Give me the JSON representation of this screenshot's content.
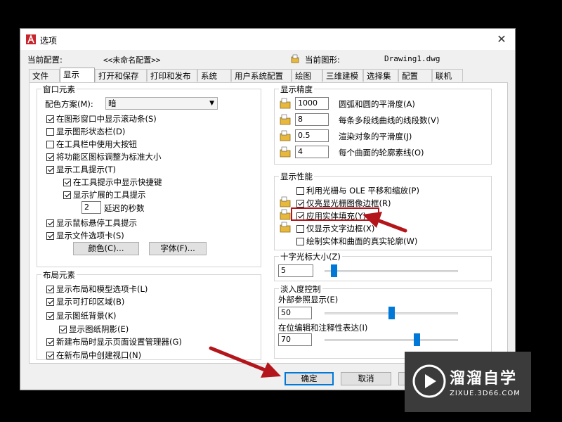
{
  "window": {
    "title": "选项",
    "close_glyph": "✕"
  },
  "profile": {
    "current_config_label": "当前配置:",
    "current_config_value": "<<未命名配置>>",
    "current_drawing_label": "当前图形:",
    "current_drawing_value": "Drawing1.dwg"
  },
  "tabs": [
    {
      "label": "文件"
    },
    {
      "label": "显示",
      "active": true
    },
    {
      "label": "打开和保存"
    },
    {
      "label": "打印和发布"
    },
    {
      "label": "系统"
    },
    {
      "label": "用户系统配置"
    },
    {
      "label": "绘图"
    },
    {
      "label": "三维建模"
    },
    {
      "label": "选择集"
    },
    {
      "label": "配置"
    },
    {
      "label": "联机"
    }
  ],
  "window_elements": {
    "title": "窗口元素",
    "color_scheme_label": "配色方案(M):",
    "color_scheme_value": "暗",
    "checkboxes": [
      {
        "label": "在图形窗口中显示滚动条(S)",
        "checked": true
      },
      {
        "label": "显示图形状态栏(D)",
        "checked": false
      },
      {
        "label": "在工具栏中使用大按钮",
        "checked": false
      },
      {
        "label": "将功能区图标调整为标准大小",
        "checked": true
      },
      {
        "label": "显示工具提示(T)",
        "checked": true
      },
      {
        "label": "在工具提示中显示快捷键",
        "checked": true
      },
      {
        "label": "显示扩展的工具提示",
        "checked": true
      },
      {
        "label": "显示鼠标悬停工具提示",
        "checked": true
      },
      {
        "label": "显示文件选项卡(S)",
        "checked": true
      }
    ],
    "delay_value": "2",
    "delay_label": "延迟的秒数",
    "colors_button": "颜色(C)...",
    "fonts_button": "字体(F)..."
  },
  "layout_elements": {
    "title": "布局元素",
    "checkboxes": [
      {
        "label": "显示布局和模型选项卡(L)",
        "checked": true
      },
      {
        "label": "显示可打印区域(B)",
        "checked": true
      },
      {
        "label": "显示图纸背景(K)",
        "checked": true
      },
      {
        "label": "显示图纸阴影(E)",
        "checked": true
      },
      {
        "label": "新建布局时显示页面设置管理器(G)",
        "checked": true
      },
      {
        "label": "在新布局中创建视口(N)",
        "checked": true
      }
    ]
  },
  "display_resolution": {
    "title": "显示精度",
    "rows": [
      {
        "value": "1000",
        "label": "圆弧和圆的平滑度(A)"
      },
      {
        "value": "8",
        "label": "每条多段线曲线的线段数(V)"
      },
      {
        "value": "0.5",
        "label": "渲染对象的平滑度(J)"
      },
      {
        "value": "4",
        "label": "每个曲面的轮廓素线(O)"
      }
    ]
  },
  "display_performance": {
    "title": "显示性能",
    "checkboxes": [
      {
        "label": "利用光栅与 OLE 平移和缩放(P)",
        "checked": false
      },
      {
        "label": "仅亮显光栅图像边框(R)",
        "checked": true
      },
      {
        "label": "应用实体填充(Y)",
        "checked": true
      },
      {
        "label": "仅显示文字边框(X)",
        "checked": false
      },
      {
        "label": "绘制实体和曲面的真实轮廓(W)",
        "checked": false
      }
    ]
  },
  "crosshair": {
    "title": "十字光标大小(Z)",
    "value": "5",
    "level_percent": 5
  },
  "fade": {
    "title": "淡入度控制",
    "xref_label": "外部参照显示(E)",
    "xref_value": "50",
    "xref_percent": 50,
    "inplace_label": "在位编辑和注释性表达(I)",
    "inplace_value": "70",
    "inplace_percent": 70
  },
  "buttons": {
    "ok": "确定",
    "cancel": "取消"
  },
  "watermark": {
    "brand": "溜溜自学",
    "url": "ZIXUE.3D66.COM"
  },
  "colors": {
    "highlight": "#b3151b",
    "accent": "#0078d7",
    "folder": "#e8b83c"
  }
}
